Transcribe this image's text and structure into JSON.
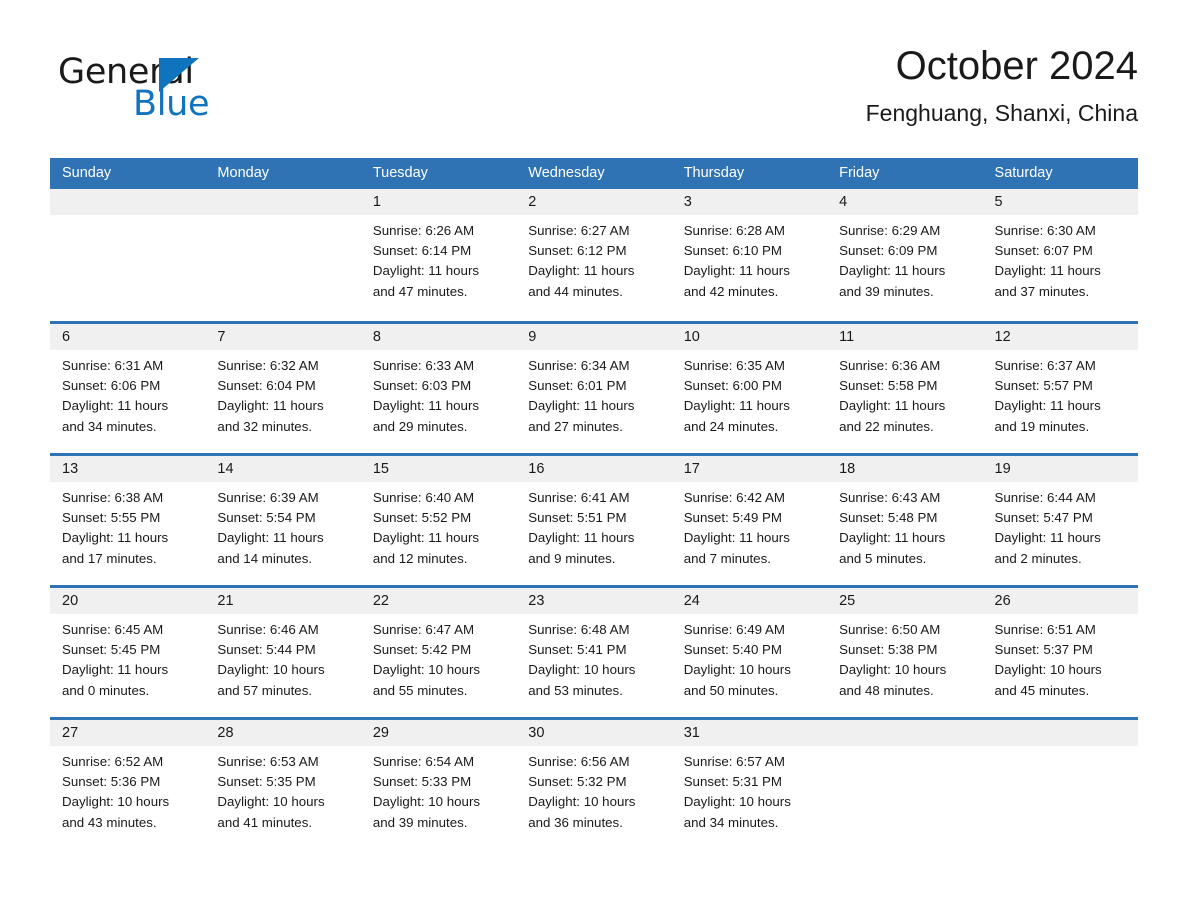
{
  "brand": {
    "name_part1": "General",
    "name_part2": "Blue",
    "triangle_color": "#1073bd",
    "text_color": "#1a1a1a"
  },
  "header": {
    "title": "October 2024",
    "subtitle": "Fenghuang, Shanxi, China"
  },
  "theme": {
    "header_blue": "#3073b4",
    "day_band_gray": "#f0f0f0",
    "text": "#1a1a1a",
    "page_background": "#ffffff"
  },
  "weekdays": [
    "Sunday",
    "Monday",
    "Tuesday",
    "Wednesday",
    "Thursday",
    "Friday",
    "Saturday"
  ],
  "weeks": [
    [
      {
        "day": "",
        "lines": []
      },
      {
        "day": "",
        "lines": []
      },
      {
        "day": "1",
        "lines": [
          "Sunrise: 6:26 AM",
          "Sunset: 6:14 PM",
          "Daylight: 11 hours",
          "and 47 minutes."
        ]
      },
      {
        "day": "2",
        "lines": [
          "Sunrise: 6:27 AM",
          "Sunset: 6:12 PM",
          "Daylight: 11 hours",
          "and 44 minutes."
        ]
      },
      {
        "day": "3",
        "lines": [
          "Sunrise: 6:28 AM",
          "Sunset: 6:10 PM",
          "Daylight: 11 hours",
          "and 42 minutes."
        ]
      },
      {
        "day": "4",
        "lines": [
          "Sunrise: 6:29 AM",
          "Sunset: 6:09 PM",
          "Daylight: 11 hours",
          "and 39 minutes."
        ]
      },
      {
        "day": "5",
        "lines": [
          "Sunrise: 6:30 AM",
          "Sunset: 6:07 PM",
          "Daylight: 11 hours",
          "and 37 minutes."
        ]
      }
    ],
    [
      {
        "day": "6",
        "lines": [
          "Sunrise: 6:31 AM",
          "Sunset: 6:06 PM",
          "Daylight: 11 hours",
          "and 34 minutes."
        ]
      },
      {
        "day": "7",
        "lines": [
          "Sunrise: 6:32 AM",
          "Sunset: 6:04 PM",
          "Daylight: 11 hours",
          "and 32 minutes."
        ]
      },
      {
        "day": "8",
        "lines": [
          "Sunrise: 6:33 AM",
          "Sunset: 6:03 PM",
          "Daylight: 11 hours",
          "and 29 minutes."
        ]
      },
      {
        "day": "9",
        "lines": [
          "Sunrise: 6:34 AM",
          "Sunset: 6:01 PM",
          "Daylight: 11 hours",
          "and 27 minutes."
        ]
      },
      {
        "day": "10",
        "lines": [
          "Sunrise: 6:35 AM",
          "Sunset: 6:00 PM",
          "Daylight: 11 hours",
          "and 24 minutes."
        ]
      },
      {
        "day": "11",
        "lines": [
          "Sunrise: 6:36 AM",
          "Sunset: 5:58 PM",
          "Daylight: 11 hours",
          "and 22 minutes."
        ]
      },
      {
        "day": "12",
        "lines": [
          "Sunrise: 6:37 AM",
          "Sunset: 5:57 PM",
          "Daylight: 11 hours",
          "and 19 minutes."
        ]
      }
    ],
    [
      {
        "day": "13",
        "lines": [
          "Sunrise: 6:38 AM",
          "Sunset: 5:55 PM",
          "Daylight: 11 hours",
          "and 17 minutes."
        ]
      },
      {
        "day": "14",
        "lines": [
          "Sunrise: 6:39 AM",
          "Sunset: 5:54 PM",
          "Daylight: 11 hours",
          "and 14 minutes."
        ]
      },
      {
        "day": "15",
        "lines": [
          "Sunrise: 6:40 AM",
          "Sunset: 5:52 PM",
          "Daylight: 11 hours",
          "and 12 minutes."
        ]
      },
      {
        "day": "16",
        "lines": [
          "Sunrise: 6:41 AM",
          "Sunset: 5:51 PM",
          "Daylight: 11 hours",
          "and 9 minutes."
        ]
      },
      {
        "day": "17",
        "lines": [
          "Sunrise: 6:42 AM",
          "Sunset: 5:49 PM",
          "Daylight: 11 hours",
          "and 7 minutes."
        ]
      },
      {
        "day": "18",
        "lines": [
          "Sunrise: 6:43 AM",
          "Sunset: 5:48 PM",
          "Daylight: 11 hours",
          "and 5 minutes."
        ]
      },
      {
        "day": "19",
        "lines": [
          "Sunrise: 6:44 AM",
          "Sunset: 5:47 PM",
          "Daylight: 11 hours",
          "and 2 minutes."
        ]
      }
    ],
    [
      {
        "day": "20",
        "lines": [
          "Sunrise: 6:45 AM",
          "Sunset: 5:45 PM",
          "Daylight: 11 hours",
          "and 0 minutes."
        ]
      },
      {
        "day": "21",
        "lines": [
          "Sunrise: 6:46 AM",
          "Sunset: 5:44 PM",
          "Daylight: 10 hours",
          "and 57 minutes."
        ]
      },
      {
        "day": "22",
        "lines": [
          "Sunrise: 6:47 AM",
          "Sunset: 5:42 PM",
          "Daylight: 10 hours",
          "and 55 minutes."
        ]
      },
      {
        "day": "23",
        "lines": [
          "Sunrise: 6:48 AM",
          "Sunset: 5:41 PM",
          "Daylight: 10 hours",
          "and 53 minutes."
        ]
      },
      {
        "day": "24",
        "lines": [
          "Sunrise: 6:49 AM",
          "Sunset: 5:40 PM",
          "Daylight: 10 hours",
          "and 50 minutes."
        ]
      },
      {
        "day": "25",
        "lines": [
          "Sunrise: 6:50 AM",
          "Sunset: 5:38 PM",
          "Daylight: 10 hours",
          "and 48 minutes."
        ]
      },
      {
        "day": "26",
        "lines": [
          "Sunrise: 6:51 AM",
          "Sunset: 5:37 PM",
          "Daylight: 10 hours",
          "and 45 minutes."
        ]
      }
    ],
    [
      {
        "day": "27",
        "lines": [
          "Sunrise: 6:52 AM",
          "Sunset: 5:36 PM",
          "Daylight: 10 hours",
          "and 43 minutes."
        ]
      },
      {
        "day": "28",
        "lines": [
          "Sunrise: 6:53 AM",
          "Sunset: 5:35 PM",
          "Daylight: 10 hours",
          "and 41 minutes."
        ]
      },
      {
        "day": "29",
        "lines": [
          "Sunrise: 6:54 AM",
          "Sunset: 5:33 PM",
          "Daylight: 10 hours",
          "and 39 minutes."
        ]
      },
      {
        "day": "30",
        "lines": [
          "Sunrise: 6:56 AM",
          "Sunset: 5:32 PM",
          "Daylight: 10 hours",
          "and 36 minutes."
        ]
      },
      {
        "day": "31",
        "lines": [
          "Sunrise: 6:57 AM",
          "Sunset: 5:31 PM",
          "Daylight: 10 hours",
          "and 34 minutes."
        ]
      },
      {
        "day": "",
        "lines": []
      },
      {
        "day": "",
        "lines": []
      }
    ]
  ]
}
